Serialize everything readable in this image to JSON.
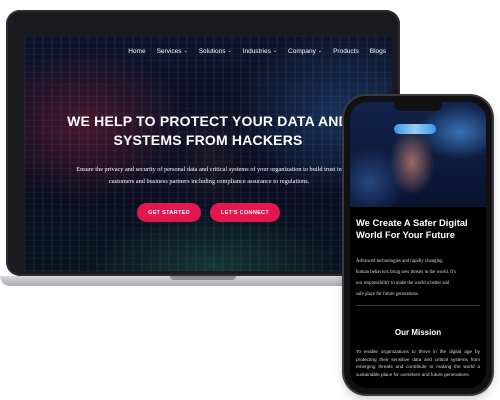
{
  "laptop": {
    "nav": [
      {
        "label": "Home",
        "has_dropdown": false
      },
      {
        "label": "Services",
        "has_dropdown": true
      },
      {
        "label": "Solutions",
        "has_dropdown": true
      },
      {
        "label": "Industries",
        "has_dropdown": true
      },
      {
        "label": "Company",
        "has_dropdown": true
      },
      {
        "label": "Products",
        "has_dropdown": false
      },
      {
        "label": "Blogs",
        "has_dropdown": false
      }
    ],
    "hero": {
      "title_line1": "WE HELP TO PROTECT YOUR DATA AND",
      "title_line2": "SYSTEMS FROM HACKERS",
      "subtitle_line1": "Ensure the privacy and security of personal data and critical systems of your organization to build trust in",
      "subtitle_line2": "customers and business partners including compliance assurance to regulations.",
      "btn_primary": "GET STARTED",
      "btn_secondary": "LET'S CONNECT"
    }
  },
  "phone": {
    "title": "We Create A Safer Digital World For Your Future",
    "paragraph_lines": [
      "Advanced technologies and rapidly changing",
      "human behaviors bring new threats to the world. It's",
      "our responsibility to make the world a better and",
      "safe place for future generations."
    ],
    "mission_heading": "Our Mission",
    "mission_text": "To enable organizations to thrive in the digital age by protecting their sensitive data and critical systems from emerging threats and contribute to making the world a sustainable place for ourselves and future generations."
  },
  "colors": {
    "accent": "#e2174f",
    "device_frame": "#1b1b1f",
    "phone_bg": "#000000"
  },
  "icons": {
    "dropdown": "chevron-down-icon"
  }
}
